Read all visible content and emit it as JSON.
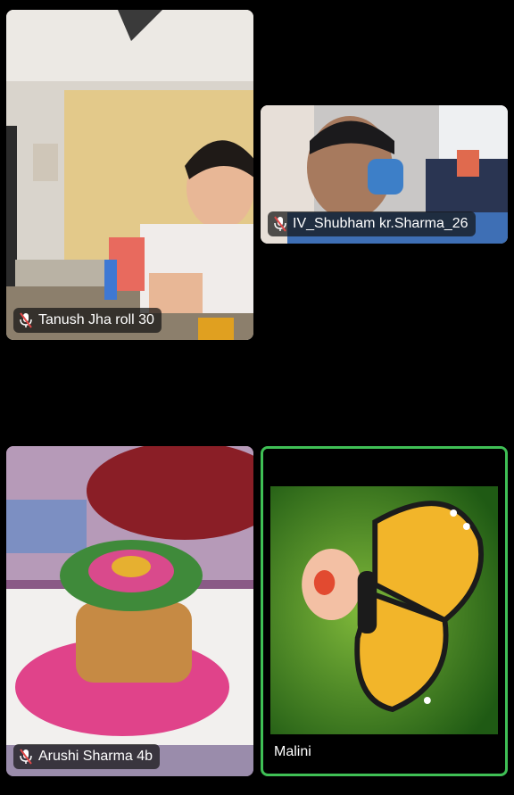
{
  "participants": [
    {
      "name": "Tanush Jha roll 30",
      "muted": true,
      "mic_icon": "mic-off-icon"
    },
    {
      "name": "IV_Shubham kr.Sharma_26",
      "muted": true,
      "mic_icon": "mic-off-icon"
    },
    {
      "name": "Arushi Sharma 4b",
      "muted": true,
      "mic_icon": "mic-off-icon"
    },
    {
      "name": "Malini",
      "muted": false,
      "active_speaker": true,
      "active_border_color": "#3fbf55"
    }
  ],
  "colors": {
    "background": "#000000",
    "active_speaker_border": "#3fbf55",
    "chip_background": "rgba(20,20,20,0.72)",
    "muted_mic": "#e04848"
  }
}
